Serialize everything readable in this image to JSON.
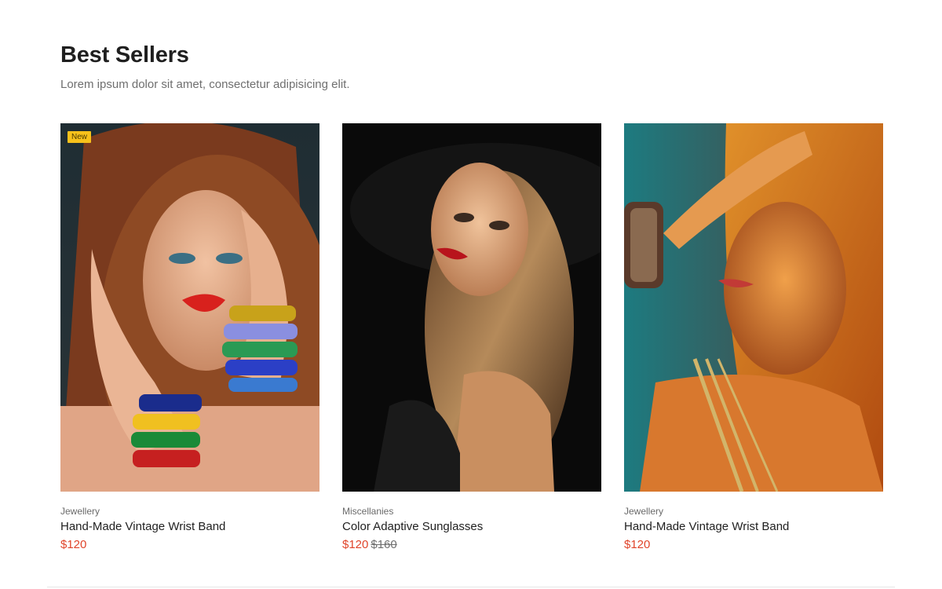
{
  "section": {
    "title": "Best Sellers",
    "subtitle": "Lorem ipsum dolor sit amet, consectetur adipisicing elit."
  },
  "products": [
    {
      "badge": "New",
      "category": "Jewellery",
      "name": "Hand-Made Vintage Wrist Band",
      "price": "$120",
      "old_price": ""
    },
    {
      "badge": "",
      "category": "Miscellanies",
      "name": "Color Adaptive Sunglasses",
      "price": "$120",
      "old_price": "$160"
    },
    {
      "badge": "",
      "category": "Jewellery",
      "name": "Hand-Made Vintage Wrist Band",
      "price": "$120",
      "old_price": ""
    }
  ],
  "colors": {
    "price": "#e0452b",
    "badge": "#f7c11b"
  }
}
